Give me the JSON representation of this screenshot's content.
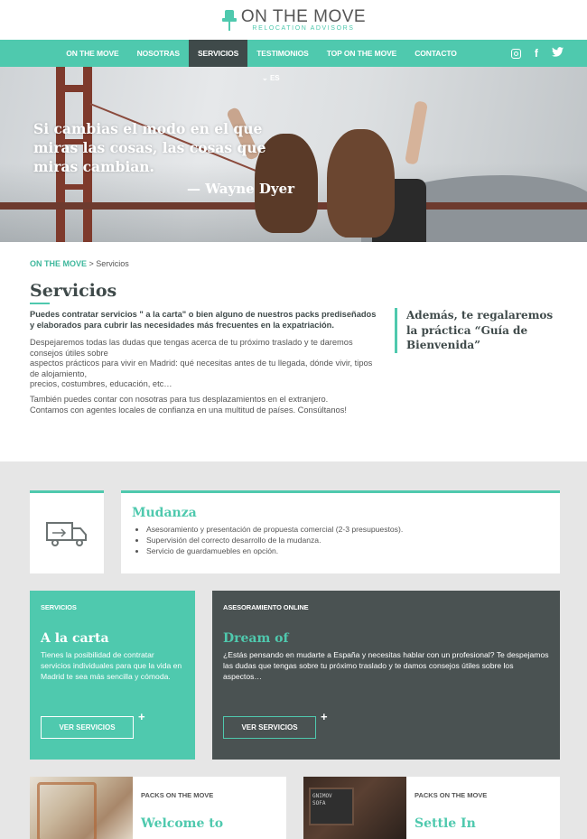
{
  "brand": {
    "name": "ON THE MOVE",
    "tagline": "RELOCATION ADVISORS",
    "accent": "#4fc9ae",
    "dark": "#4a5252"
  },
  "nav": {
    "items": [
      {
        "label": "ON THE MOVE"
      },
      {
        "label": "NOSOTRAS"
      },
      {
        "label": "SERVICIOS",
        "active": true
      },
      {
        "label": "TESTIMONIOS"
      },
      {
        "label": "TOP ON THE MOVE"
      },
      {
        "label": "CONTACTO"
      }
    ],
    "social": [
      "instagram-icon",
      "facebook-icon",
      "twitter-icon"
    ],
    "language": "ES"
  },
  "hero": {
    "quote": "Si cambias el modo en el que miras las cosas, las cosas que miras cambian.",
    "author": "— Wayne Dyer"
  },
  "breadcrumb": {
    "home": "ON THE MOVE",
    "separator": " > ",
    "current": "Servicios"
  },
  "page": {
    "title": "Servicios",
    "intro": "Puedes contratar servicios \" a la carta\" o bien alguno de nuestros packs prediseñados y elaborados para cubrir las necesidades más frecuentes en la expatriación.",
    "paragraph1": "Despejaremos todas las dudas que tengas acerca de tu próximo traslado y te daremos consejos útiles sobre\naspectos prácticos para vivir en Madrid: qué necesitas antes de tu llegada, dónde vivir, tipos de alojamiento,\nprecios, costumbres, educación, etc…",
    "paragraph2": "También puedes contar con nosotras para tus desplazamientos en el extranjero.\nContamos con agentes locales de confianza en una multitud de países. Consúltanos!",
    "aside": "Además, te regalaremos la práctica “Guía de Bienvenida”"
  },
  "mudanza": {
    "icon": "truck-icon",
    "title": "Mudanza",
    "items": [
      "Asesoramiento y presentación de propuesta comercial (2-3 presupuestos).",
      "Supervisión del correcto desarrollo de la mudanza.",
      "Servicio de guardamuebles en opción."
    ]
  },
  "cards": [
    {
      "kicker": "SERVICIOS",
      "title": "A la carta",
      "text": "Tienes la posibilidad de contratar servicios individuales para que la vida en Madrid te sea más sencilla y cómoda.",
      "button": "VER SERVICIOS",
      "plus": "+"
    },
    {
      "kicker": "ASESORAMIENTO ONLINE",
      "title": "Dream of",
      "text": "¿Estás pensando en mudarte a España y necesitas hablar con un profesional? Te despejamos las dudas que tengas sobre tu próximo traslado y te damos consejos útiles sobre los aspectos…",
      "button": "VER SERVICIOS",
      "plus": "+"
    }
  ],
  "packs": [
    {
      "kicker": "PACKS ON THE MOVE",
      "title": "Welcome to"
    },
    {
      "kicker": "PACKS ON THE MOVE",
      "title": "Settle In",
      "image_text": "GNIMOV\nSOFA"
    }
  ]
}
